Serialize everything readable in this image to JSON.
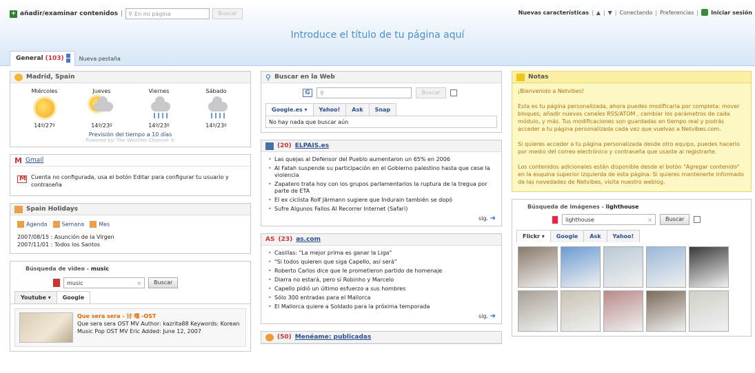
{
  "topbar": {
    "add_label": "añadir/examinar contenidos",
    "search_placeholder": "En mi página",
    "search_button": "Buscar",
    "new_features": "Nuevas características",
    "links": [
      "Conectando",
      "Preferencias"
    ],
    "login": "Iniciar sesión"
  },
  "page_title": "Introduce el título de tu página aquí",
  "tabs": {
    "general_label": "General",
    "general_count": "(103)",
    "new_tab": "Nueva pestaña"
  },
  "weather": {
    "title": "Madrid, Spain",
    "days": [
      {
        "name": "Miércoles",
        "temp": "14º/27º",
        "icon": "sunny-icon"
      },
      {
        "name": "Jueves",
        "temp": "14º/23º",
        "icon": "partly-cloudy-icon"
      },
      {
        "name": "Viernes",
        "temp": "14º/23º",
        "icon": "rain-icon"
      },
      {
        "name": "Sábado",
        "temp": "14º/23º",
        "icon": "rain-icon"
      }
    ],
    "forecast_link": "Previsión del tiempo a 10 días",
    "powered": "Powered by: The Weather Channel ®"
  },
  "gmail": {
    "title": "Gmail",
    "message": "Cuenta no configurada, usa el botón Editar para configurar tu usuario y contraseña"
  },
  "holidays": {
    "title": "Spain Holidays",
    "links": [
      "Agenda",
      "Semana",
      "Mes"
    ],
    "rows": [
      "2007/08/15 : Asunción de la Virgen",
      "2007/11/01 : Todos los Santos"
    ]
  },
  "video": {
    "title_prefix": "Búsqueda de video - ",
    "query": "music",
    "search_button": "Buscar",
    "tabs": [
      "Youtube",
      "Google"
    ],
    "result_title": "Que sera sera - 讨 嘿 -OST",
    "result_desc": "Que sera sera OST MV Author: kazrita88 Keywords: Korean Music Pop OST MV Eric Added: June 12, 2007"
  },
  "websearch": {
    "title": "Buscar en la Web",
    "button": "Buscar",
    "tabs": [
      "Google.es",
      "Yahoo!",
      "Ask",
      "Snap"
    ],
    "result": "No hay nada que buscar aún"
  },
  "elpais": {
    "count": "(20)",
    "title": "ELPAIS.es",
    "items": [
      "Las quejas al Defensor del Pueblo aumentaron un 65% en 2006",
      "Al Fatah suspende su participación en el Gobierno palestino hasta que cese la violencia",
      "Zapatero trata hoy con los grupos parlamentarios la ruptura de la tregua por parte de ETA",
      "El ex ciclista Rolf Järmann sugiere que Indurain también se dopó",
      "Sufre Algunos Fallos Al Recorrer Internet (Safari)"
    ],
    "next": "sig."
  },
  "ascom": {
    "count": "(23)",
    "title": "as.com",
    "items": [
      "Casillas: \"La mejor prima es ganar la Liga\"",
      "\"Si todos quieren que siga Capello, así será\"",
      "Roberto Carlos dice que le prometieron partido de homenaje",
      "Diarra no estará, pero sí Robinho y Marcelo",
      "Capello pidió un último esfuerzo a sus hombres",
      "Sólo 300 entradas para el Mallorca",
      "El Mallorca quiere a Soldado para la próxima temporada"
    ],
    "next": "sig."
  },
  "meneame": {
    "count": "(50)",
    "title": "Menéame: publicadas"
  },
  "notes": {
    "title": "Notas",
    "paragraphs": [
      "¡Bienvenido a Netvibes!",
      "Esta es tu página personalizada, ahora puedes modificarla por completa: mover bloques, añadir nuevos canales RSS/ATOM , cambiar los parámetros de cada módulo, y más. Tus modificaciones son guardadas en tiempo real y podrás acceder a tu página personalizada cada vez que vuelvas a Netvibes.com.",
      "Si quieres acceder a tu página personalizada desde otro equipo, puedes hacerlo por medio del correo electrónico y contraseña que usaste al registrarte.",
      "Los contenidos adicionales están disponible desde el botón \"Agregar contenido\" en la esquina superior izquierda de esta página. Si quieres mantenerte informado de las novedades de Netvibes, visita nuestro weblog."
    ]
  },
  "images": {
    "title_prefix": "Búsqueda de imágenes - ",
    "query": "lighthouse",
    "button": "Buscar",
    "tabs": [
      "Flickr",
      "Google",
      "Ask",
      "Yahoo!"
    ],
    "thumb_colors": [
      "#8a7a6a",
      "#6c9bd2",
      "#b9c9d6",
      "#9bb8d8",
      "#3a3a3a",
      "#a8a095",
      "#c9c3b3",
      "#b98a8a",
      "#7a6a5a",
      "#d0d0c8"
    ]
  }
}
